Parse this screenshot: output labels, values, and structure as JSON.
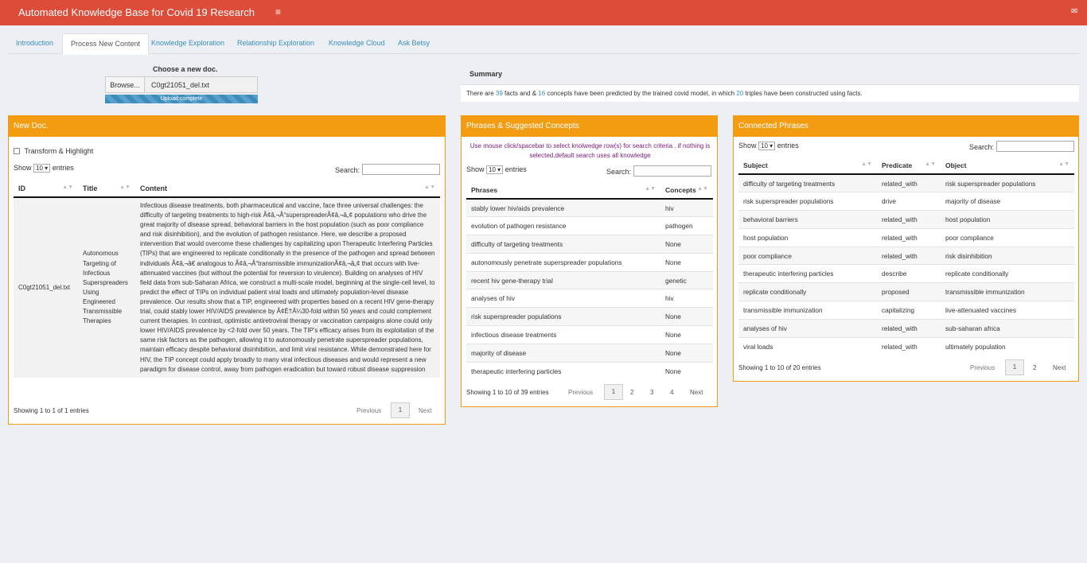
{
  "app": {
    "title": "Automated Knowledge Base for Covid 19 Research"
  },
  "tabs": [
    "Introduction",
    "Process New Content",
    "Knowledge Exploration",
    "Relationship Exploration",
    "Knowledge Cloud",
    "Ask Betsy"
  ],
  "upload": {
    "label": "Choose a new doc.",
    "browse": "Browse...",
    "filename": "C0gt21051_del.txt",
    "status": "Upload complete",
    "progress_fraction": 1.0
  },
  "summary": {
    "heading": "Summary",
    "text_pre": "There are ",
    "facts": "39",
    "text_mid1": " facts and & ",
    "concepts": "16",
    "text_mid2": " concepts have been predicted by the trained covid model, in which ",
    "triples": "20",
    "text_post": " triples have been constructed using facts."
  },
  "newdoc": {
    "title": "New Doc.",
    "checkbox_label": "Transform & Highlight",
    "show": "Show",
    "entries_value": "10",
    "entries": "entries",
    "search": "Search:",
    "columns": [
      "ID",
      "Title",
      "Content"
    ],
    "row": {
      "id": "C0gt21051_del.txt",
      "title": "Autonomous Targeting of Infectious Superspreaders Using Engineered Transmissible Therapies",
      "content": "Infectious disease treatments, both pharmaceutical and vaccine, face three universal challenges: the difficulty of targeting treatments to high-risk Ã¢â‚¬Å“superspreaderÃ¢â‚¬â„¢ populations who drive the great majority of disease spread, behavioral barriers in the host population (such as poor compliance and risk disinhibition), and the evolution of pathogen resistance. Here, we describe a proposed intervention that would overcome these challenges by capitalizing upon Therapeutic Interfering Particles (TIPs) that are engineered to replicate conditionally in the presence of the pathogen and spread between individuals Ã¢â‚¬â€ analogous to Ã¢â‚¬Å“transmissible immunizationÃ¢â‚¬â„¢ that occurs with live-attenuated vaccines (but without the potential for reversion to virulence). Building on analyses of HIV field data from sub-Saharan Africa, we construct a multi-scale model, beginning at the single-cell level, to predict the effect of TIPs on individual patient viral loads and ultimately population-level disease prevalence. Our results show that a TIP, engineered with properties based on a recent HIV gene-therapy trial, could stably lower HIV/AIDS prevalence by Ã¢Ë†Â¼30-fold within 50 years and could complement current therapies. In contrast, optimistic antiretroviral therapy or vaccination campaigns alone could only lower HIV/AIDS prevalence by <2-fold over 50 years. The TIP's efficacy arises from its exploitation of the same risk factors as the pathogen, allowing it to autonomously penetrate superspreader populations, maintain efficacy despite behavioral disinhibition, and limit viral resistance. While demonstrated here for HIV, the TIP concept could apply broadly to many viral infectious diseases and would represent a new paradigm for disease control, away from pathogen eradication but toward robust disease suppression"
    },
    "info": "Showing 1 to 1 of 1 entries",
    "prev": "Previous",
    "page": "1",
    "next": "Next"
  },
  "phrases": {
    "title": "Phrases & Suggested Concepts",
    "hint": "Use mouse click/spacebar to select knolwedge row(s) for search criteria . if nothing is selected,default search uses all knowledge",
    "show": "Show",
    "entries_value": "10",
    "entries": "entries",
    "search": "Search:",
    "columns": [
      "Phrases",
      "Concepts"
    ],
    "rows": [
      [
        "stably lower hiv/aids prevalence",
        "hiv"
      ],
      [
        "evolution of pathogen resistance",
        "pathogen"
      ],
      [
        "difficulty of targeting treatments",
        "None"
      ],
      [
        "autonomously penetrate superspreader populations",
        "None"
      ],
      [
        "recent hiv gene-therapy trial",
        "genetic"
      ],
      [
        "analyses of hiv",
        "hiv"
      ],
      [
        "risk superspreader populations",
        "None"
      ],
      [
        "infectious disease treatments",
        "None"
      ],
      [
        "majority of disease",
        "None"
      ],
      [
        "therapeutic interfering particles",
        "None"
      ]
    ],
    "info": "Showing 1 to 10 of 39 entries",
    "prev": "Previous",
    "pages": [
      "1",
      "2",
      "3",
      "4"
    ],
    "next": "Next"
  },
  "connected": {
    "title": "Connected Phrases",
    "show": "Show",
    "entries_value": "10",
    "entries": "entries",
    "search": "Search:",
    "columns": [
      "Subject",
      "Predicate",
      "Object"
    ],
    "rows": [
      [
        "difficulty of targeting treatments",
        "related_with",
        "risk superspreader populations"
      ],
      [
        "risk superspreader populations",
        "drive",
        "majority of disease"
      ],
      [
        "behavioral barriers",
        "related_with",
        "host population"
      ],
      [
        "host population",
        "related_with",
        "poor compliance"
      ],
      [
        "poor compliance",
        "related_with",
        "risk disinhibition"
      ],
      [
        "therapeutic interfering particles",
        "describe",
        "replicate conditionally"
      ],
      [
        "replicate conditionally",
        "proposed",
        "transmissible immunization"
      ],
      [
        "transmissible immunization",
        "capitalizing",
        "live-attenuated vaccines"
      ],
      [
        "analyses of hiv",
        "related_with",
        "sub-saharan africa"
      ],
      [
        "viral loads",
        "related_with",
        "ultimately population"
      ]
    ],
    "info": "Showing 1 to 10 of 20 entries",
    "prev": "Previous",
    "pages": [
      "1",
      "2"
    ],
    "next": "Next"
  }
}
